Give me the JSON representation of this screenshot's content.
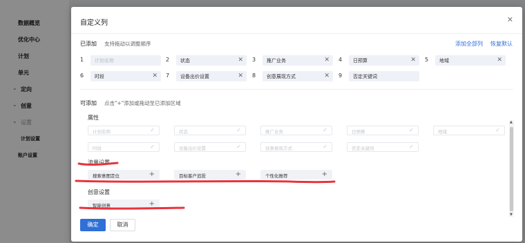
{
  "sidebar": {
    "items": [
      {
        "label": "数据概览"
      },
      {
        "label": "优化中心"
      },
      {
        "label": "计划"
      },
      {
        "label": "单元"
      },
      {
        "label": "定向"
      },
      {
        "label": "创意"
      },
      {
        "label": "设置"
      },
      {
        "label": "计划设置"
      },
      {
        "label": "账户设置"
      }
    ]
  },
  "modal": {
    "title": "自定义列",
    "close_icon": "close-icon",
    "added": {
      "label": "已添加",
      "hint": "支持拖动以调整顺序",
      "add_all": "添加全部列",
      "reset": "恢复默认",
      "items": [
        {
          "index": "1",
          "label": "计划名称",
          "disabled": true
        },
        {
          "index": "2",
          "label": "状态"
        },
        {
          "index": "3",
          "label": "推广业务"
        },
        {
          "index": "4",
          "label": "日预算"
        },
        {
          "index": "5",
          "label": "地域"
        },
        {
          "index": "6",
          "label": "时段"
        },
        {
          "index": "7",
          "label": "设备出价设置"
        },
        {
          "index": "8",
          "label": "创意展现方式"
        },
        {
          "index": "9",
          "label": "否定关键词"
        }
      ]
    },
    "available": {
      "label": "可添加",
      "hint": "点击\"+\"添加或拖动至已添加区域",
      "groups": [
        {
          "name": "属性",
          "items": [
            "计划名称",
            "状态",
            "推广业务",
            "日预算",
            "地域",
            "时段",
            "设备出价设置",
            "创意展现方式",
            "否定关键词"
          ]
        },
        {
          "name": "流量设置",
          "items": [
            "搜索意图定位",
            "目标客户追投",
            "个性化推荐"
          ]
        },
        {
          "name": "创意设置",
          "items": [
            "智能创意"
          ]
        }
      ]
    },
    "confirm": "确定",
    "cancel": "取消"
  },
  "colors": {
    "primary": "#2f6fd6",
    "annotation": "#e8333b"
  }
}
